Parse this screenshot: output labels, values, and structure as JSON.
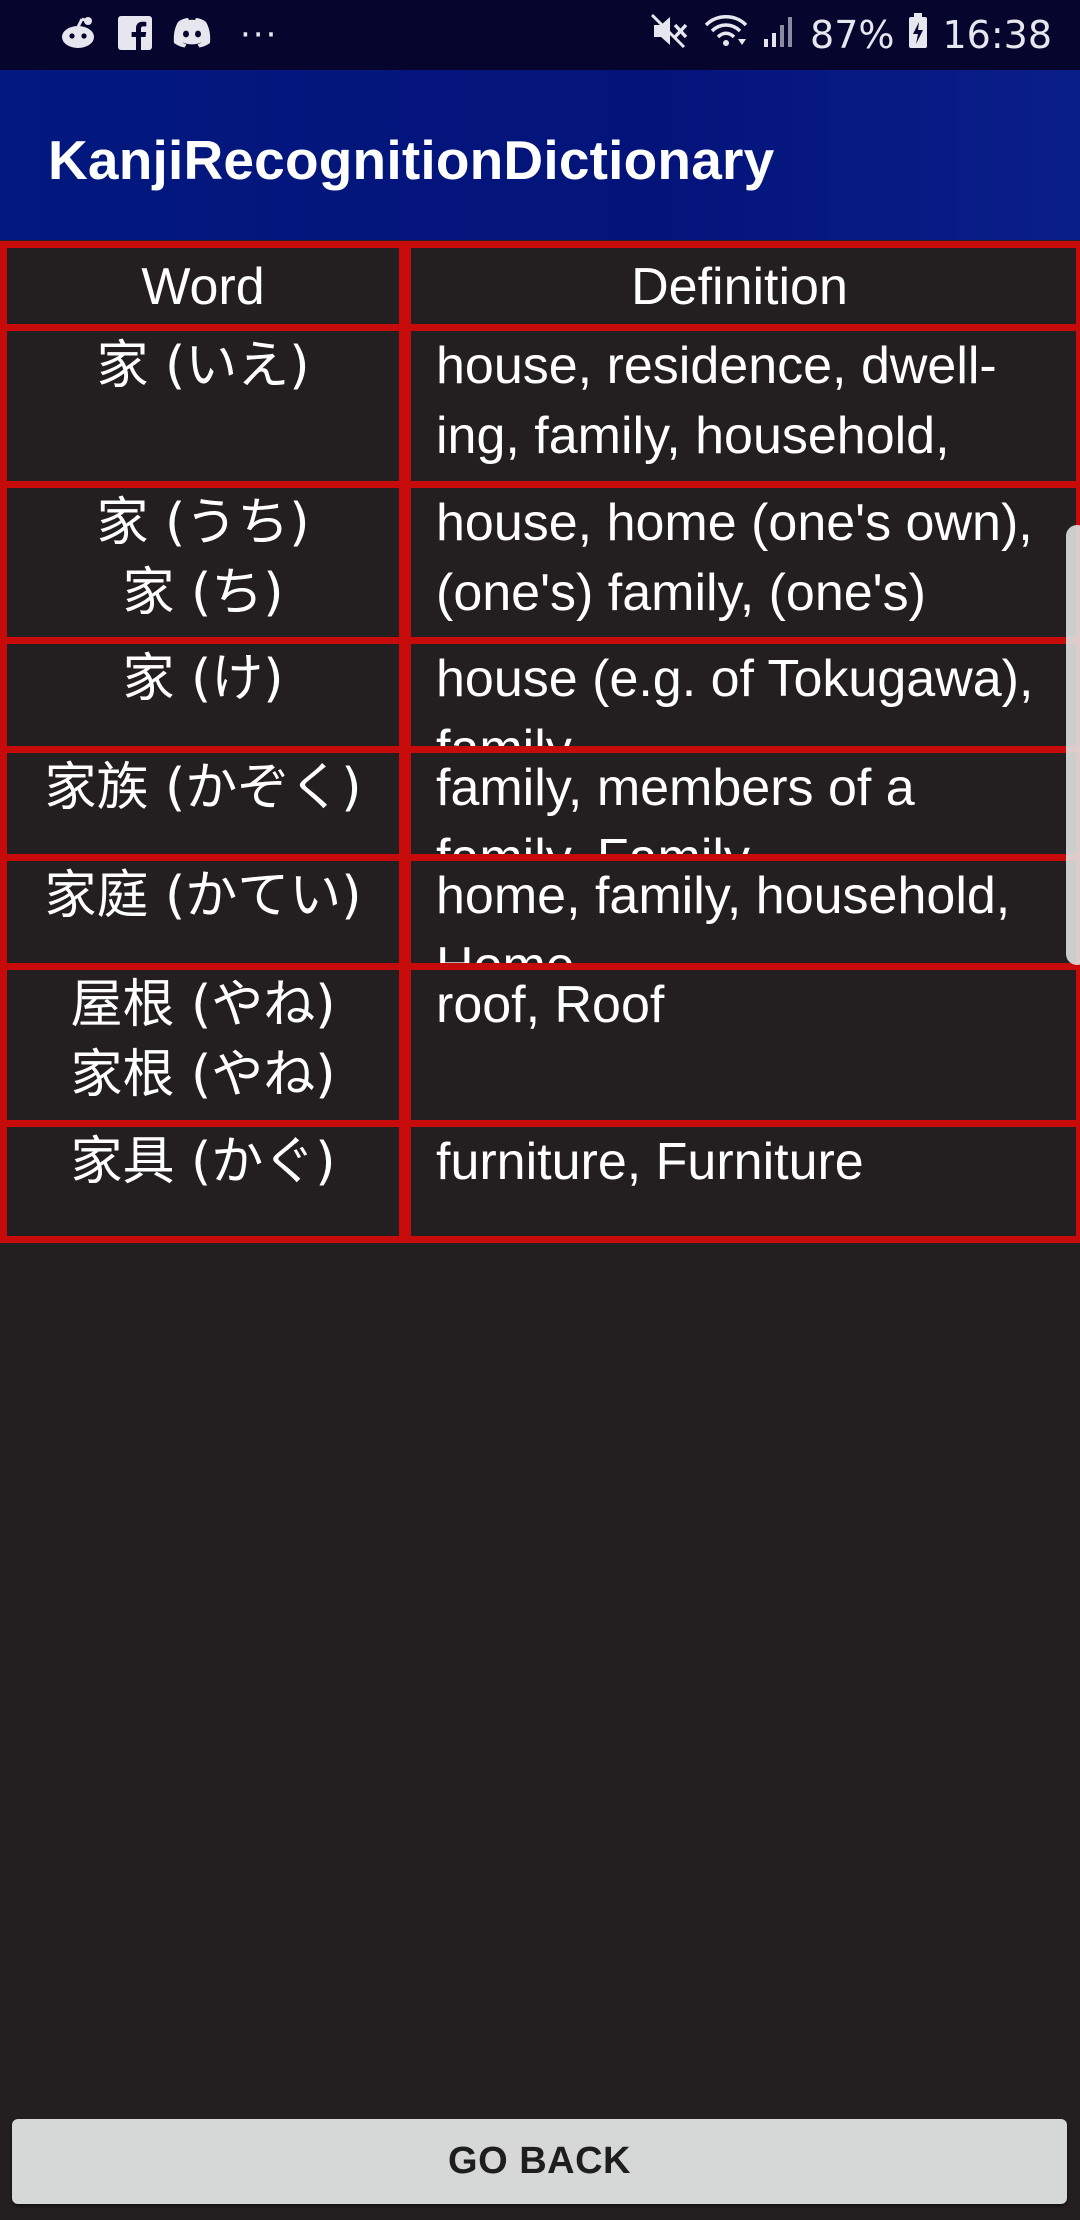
{
  "status_bar": {
    "left_icons": [
      "reddit-icon",
      "facebook-icon",
      "discord-icon",
      "more-notifications-icon"
    ],
    "more_glyph": "···",
    "battery_percent": "87%",
    "time": "16:38",
    "right_icons": [
      "mute-icon",
      "wifi-icon",
      "signal-icon",
      "battery-charging-icon"
    ]
  },
  "app_bar": {
    "title": "KanjiRecognitionDictionary"
  },
  "table": {
    "headers": {
      "word": "Word",
      "definition": "Definition"
    },
    "rows": [
      {
        "word_lines": [
          "家 (いえ)"
        ],
        "definition": "house, residence, dwell-ing, family, household, lineage, family name"
      },
      {
        "word_lines": [
          "家 (うち)",
          "家 (ち)"
        ],
        "definition": "house, home (one's own), (one's) family, (one's) household, Uchi"
      },
      {
        "word_lines": [
          "家 (け)"
        ],
        "definition": "house (e.g. of Tokugawa), family"
      },
      {
        "word_lines": [
          "家族 (かぞく)"
        ],
        "definition": "family, members of a family, Family"
      },
      {
        "word_lines": [
          "家庭 (かてい)"
        ],
        "definition": "home, family, household, Home"
      },
      {
        "word_lines": [
          "屋根 (やね)",
          "家根 (やね)"
        ],
        "definition": "roof, Roof"
      },
      {
        "word_lines": [
          "家具 (かぐ)"
        ],
        "definition": "furniture, Furniture"
      }
    ]
  },
  "footer": {
    "go_back_label": "GO BACK"
  },
  "colors": {
    "status_bar_bg": "#05052e",
    "app_bar_bg": "#03177f",
    "background": "#231f20",
    "table_border": "#c70b0b",
    "button_bg": "#d6d7d7",
    "text": "#ffffff"
  }
}
